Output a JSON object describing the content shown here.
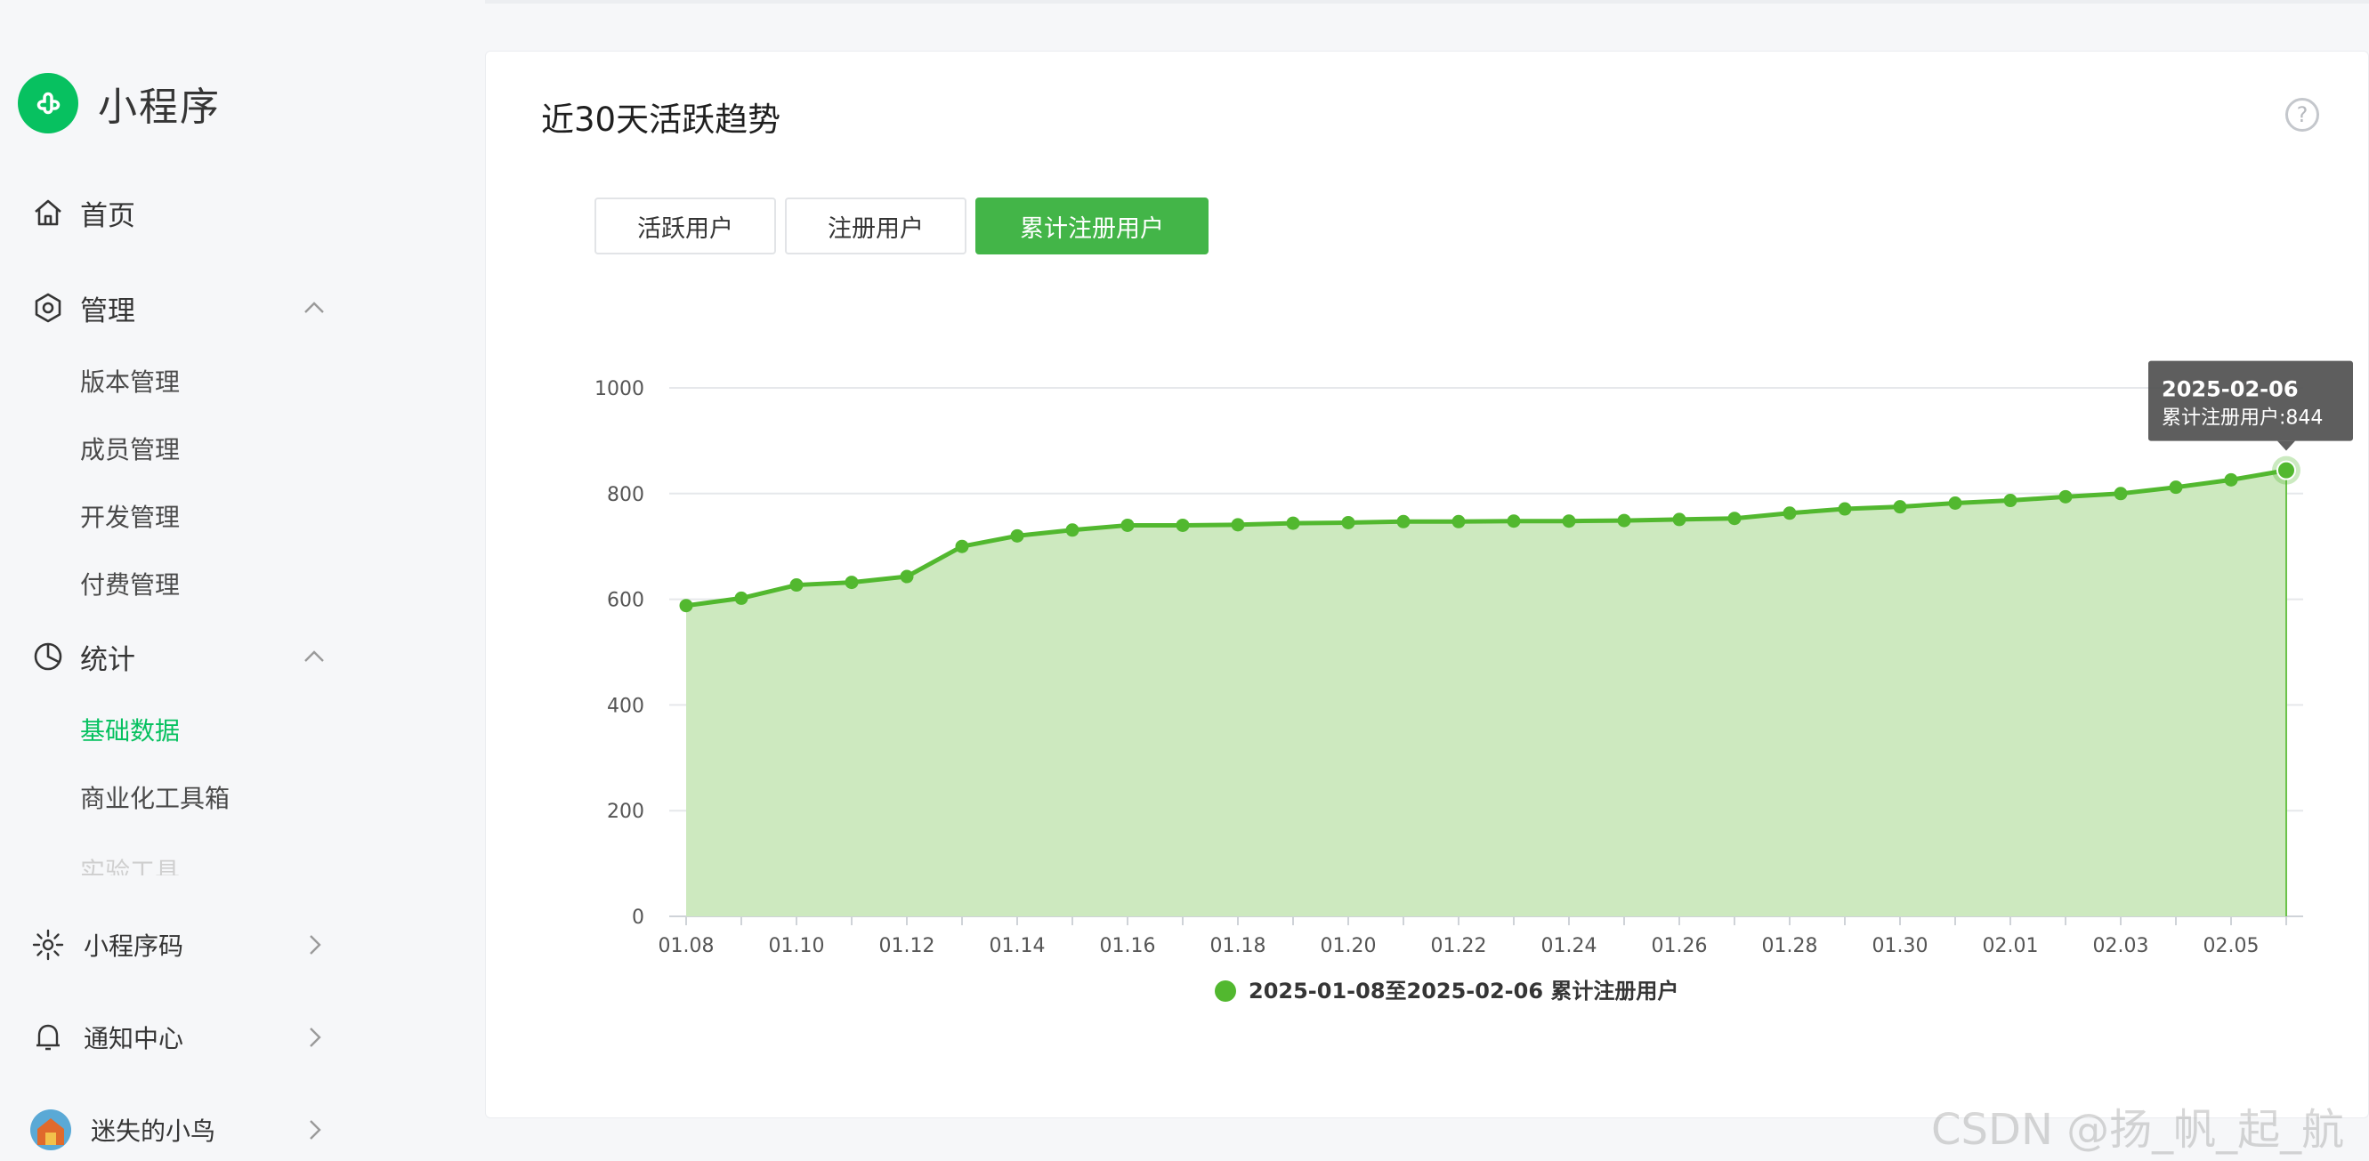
{
  "brand": {
    "name": "小程序"
  },
  "nav": {
    "home": "首页",
    "manage": "管理",
    "manage_items": [
      "版本管理",
      "成员管理",
      "开发管理",
      "付费管理"
    ],
    "stats": "统计",
    "stats_items": [
      "基础数据",
      "商业化工具箱",
      "实验工具"
    ],
    "qrcode": "小程序码",
    "notify": "通知中心",
    "user": "迷失的小鸟"
  },
  "card": {
    "title": "近30天活跃趋势",
    "help": "?",
    "tabs": [
      "活跃用户",
      "注册用户",
      "累计注册用户"
    ],
    "active_tab": 2
  },
  "tooltip": {
    "date": "2025-02-06",
    "text": "累计注册用户:844"
  },
  "colors": {
    "accent": "#07c160",
    "line": "#52b82f",
    "area": "#cde9bf",
    "tab_active": "#43b548"
  },
  "watermark": "CSDN @扬_帆_起_航",
  "chart_data": {
    "type": "area",
    "x": [
      "01.08",
      "01.09",
      "01.10",
      "01.11",
      "01.12",
      "01.13",
      "01.14",
      "01.15",
      "01.16",
      "01.17",
      "01.18",
      "01.19",
      "01.20",
      "01.21",
      "01.22",
      "01.23",
      "01.24",
      "01.25",
      "01.26",
      "01.27",
      "01.28",
      "01.29",
      "01.30",
      "01.31",
      "02.01",
      "02.02",
      "02.03",
      "02.04",
      "02.05",
      "02.06"
    ],
    "x_tick_labels": [
      "01.08",
      "01.10",
      "01.12",
      "01.14",
      "01.16",
      "01.18",
      "01.20",
      "01.22",
      "01.24",
      "01.26",
      "01.28",
      "01.30",
      "02.01",
      "02.03",
      "02.05"
    ],
    "series": [
      {
        "name": "2025-01-08至2025-02-06 累计注册用户",
        "values": [
          588,
          602,
          627,
          632,
          643,
          700,
          720,
          731,
          740,
          740,
          741,
          744,
          745,
          747,
          747,
          748,
          748,
          749,
          751,
          753,
          763,
          771,
          775,
          782,
          787,
          794,
          800,
          812,
          826,
          844
        ]
      }
    ],
    "yticks": [
      0,
      200,
      400,
      600,
      800,
      1000
    ],
    "ylim": [
      0,
      1000
    ],
    "grid": true,
    "legend": "bottom"
  }
}
